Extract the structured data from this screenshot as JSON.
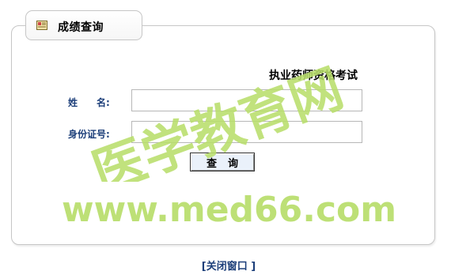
{
  "header": {
    "tab_title": "成绩查询",
    "icon": "certificate-icon"
  },
  "form": {
    "exam_title": "执业药师资格考试",
    "name_label": "姓　　名:",
    "name_value": "",
    "id_label": "身份证号:",
    "id_value": "",
    "query_button": "查询"
  },
  "footer": {
    "close_link": "[关闭窗口 ]"
  },
  "watermark": {
    "cn_text": "医学教育网",
    "url_text": "www.med66.com",
    "color": "#b8de6b"
  }
}
